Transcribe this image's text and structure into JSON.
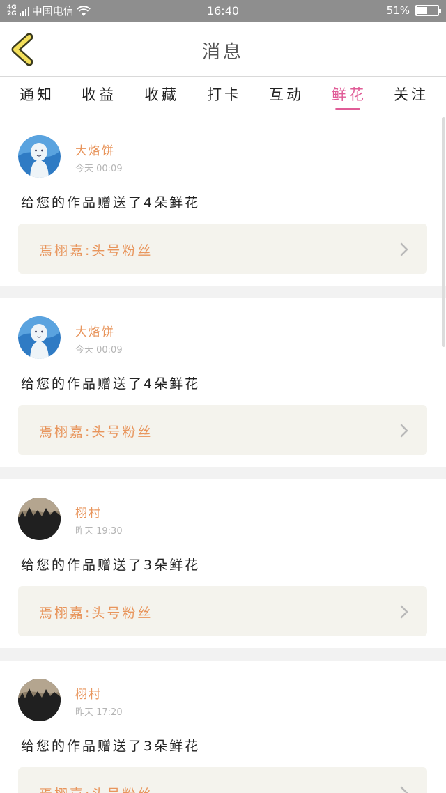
{
  "status_bar": {
    "network_top": "4G",
    "network_bottom": "2G",
    "carrier": "中国电信",
    "time": "16:40",
    "battery_text": "51%",
    "battery_level": 0.51
  },
  "nav": {
    "title": "消息",
    "back_icon": "chevron-left-icon"
  },
  "tabs": [
    {
      "label": "通知",
      "active": false
    },
    {
      "label": "收益",
      "active": false
    },
    {
      "label": "收藏",
      "active": false
    },
    {
      "label": "打卡",
      "active": false
    },
    {
      "label": "互动",
      "active": false
    },
    {
      "label": "鲜花",
      "active": true
    },
    {
      "label": "关注",
      "active": false
    }
  ],
  "messages": [
    {
      "user": "大烙饼",
      "time": "今天 00:09",
      "text": "给您的作品赠送了4朵鲜花",
      "link": "焉栩嘉:头号粉丝",
      "avatar": "cartoon-avatar"
    },
    {
      "user": "大烙饼",
      "time": "今天 00:09",
      "text": "给您的作品赠送了4朵鲜花",
      "link": "焉栩嘉:头号粉丝",
      "avatar": "cartoon-avatar"
    },
    {
      "user": "栩村",
      "time": "昨天 19:30",
      "text": "给您的作品赠送了3朵鲜花",
      "link": "焉栩嘉:头号粉丝",
      "avatar": "landscape-avatar"
    },
    {
      "user": "栩村",
      "time": "昨天 17:20",
      "text": "给您的作品赠送了3朵鲜花",
      "link": "焉栩嘉:头号粉丝",
      "avatar": "landscape-avatar"
    }
  ],
  "colors": {
    "accent": "#e05c97",
    "username": "#e8955c",
    "link_bg": "#f4f3ed",
    "status_bar": "#8e8e8e"
  }
}
